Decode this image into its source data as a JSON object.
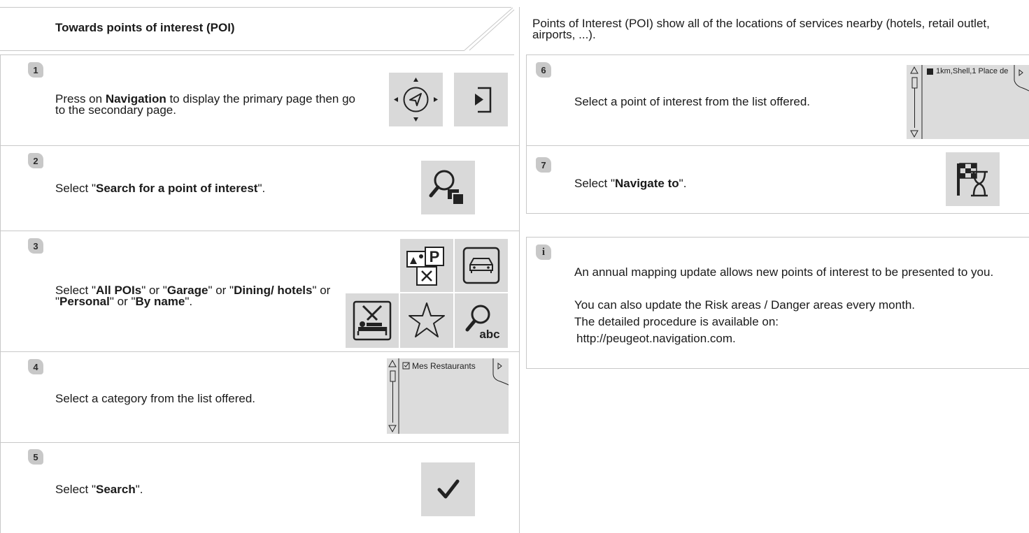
{
  "header": {
    "title": "Towards points of interest (POI)",
    "intro": "Points of Interest (POI) show all of the locations of services nearby (hotels, retail outlet, airports, ...)."
  },
  "steps": [
    {
      "number": "1",
      "parts": [
        "Press on ",
        "Navigation",
        " to display the primary page then go to the secondary page."
      ]
    },
    {
      "number": "2",
      "parts": [
        "Select \"",
        "Search for a point of interest",
        "\"."
      ]
    },
    {
      "number": "3",
      "parts": [
        "Select \"",
        "All POIs",
        "\" or \"",
        "Garage",
        "\" or \"",
        "Dining/ hotels",
        "\" or \"",
        "Personal",
        "\" or \"",
        "By name",
        "\"."
      ]
    },
    {
      "number": "4",
      "text": "Select a category from the list offered."
    },
    {
      "number": "5",
      "parts": [
        "Select \"",
        "Search",
        "\"."
      ]
    },
    {
      "number": "6",
      "text": "Select a point of interest from the list offered."
    },
    {
      "number": "7",
      "parts": [
        "Select \"",
        "Navigate to",
        "\"."
      ]
    }
  ],
  "thumbs": {
    "category_item": "Mes Restaurants",
    "poi_item": "1km,Shell,1 Place de"
  },
  "icons": {
    "abc_label": "abc",
    "parking_label": "P"
  },
  "info": {
    "badge": "i",
    "lines": [
      "An annual mapping update allows new points of interest to be presented to you.",
      "You can also update the Risk areas / Danger areas every month.",
      "The detailed procedure is available on:",
      "http://peugeot.navigation.com."
    ]
  },
  "colors": {
    "badge_bg": "#c8c8c8",
    "icon_bg": "#d9d9d9",
    "rule": "#c8c8c8"
  }
}
